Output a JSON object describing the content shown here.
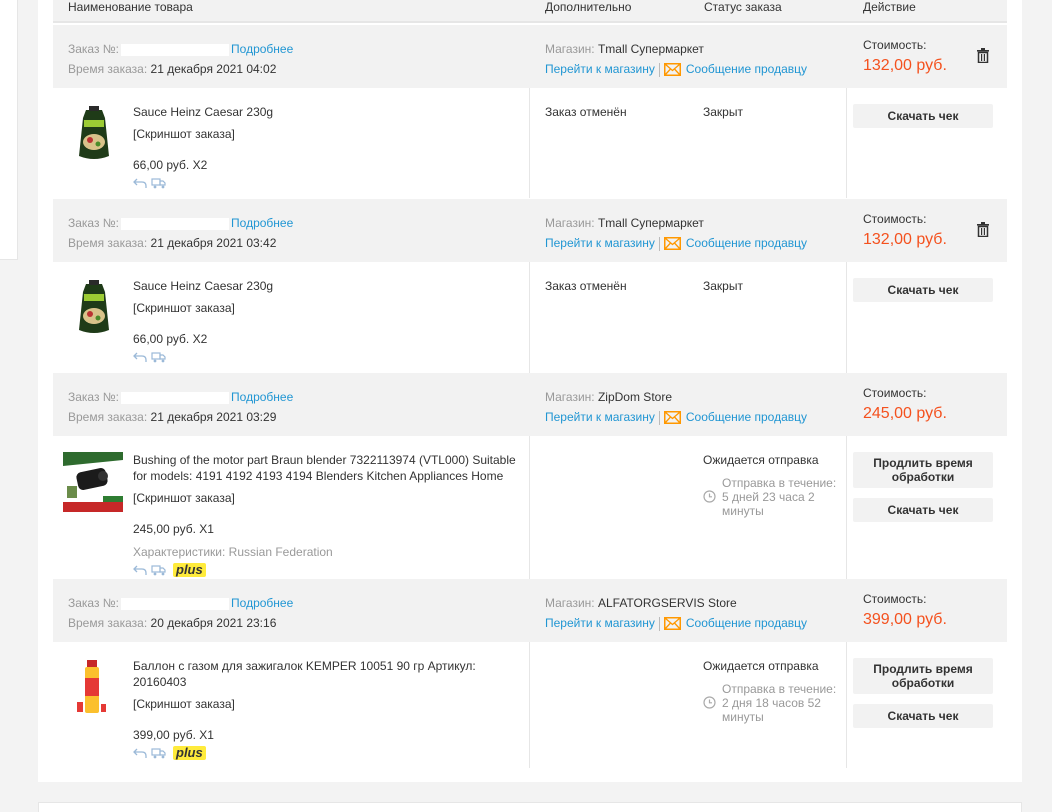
{
  "table_header": {
    "name": "Наименование товара",
    "extra": "Дополнительно",
    "status": "Статус заказа",
    "action": "Действие"
  },
  "labels": {
    "order_no": "Заказ №:",
    "order_time": "Время заказа:",
    "details": "Подробнее",
    "shop": "Магазин:",
    "go_shop": "Перейти к магазину",
    "message_seller": "Сообщение продавцу",
    "cost": "Стоимость:",
    "download_receipt": "Скачать чек",
    "extend_processing": "Продлить время обработки",
    "screenshot": "[Скриншот заказа]",
    "ship_within": "Отправка в течение:",
    "characteristics": "Характеристики:",
    "plus": "plus"
  },
  "orders": [
    {
      "time": "21 декабря 2021 04:02",
      "shop": "Tmall Супермаркет",
      "cost": "132,00 руб.",
      "product": "Sauce Heinz Caesar 230g",
      "price": "66,00 руб. X2",
      "extra": "Заказ отменён",
      "status": "Закрыт"
    },
    {
      "time": "21 декабря 2021 03:42",
      "shop": "Tmall Супермаркет",
      "cost": "132,00 руб.",
      "product": "Sauce Heinz Caesar 230g",
      "price": "66,00 руб. X2",
      "extra": "Заказ отменён",
      "status": "Закрыт"
    },
    {
      "time": "21 декабря 2021 03:29",
      "shop": "ZipDom Store",
      "cost": "245,00 руб.",
      "product": "Bushing of the motor part Braun blender 7322113974 (VTL000) Suitable for models: 4191 4192 4193 4194 Blenders Kitchen Appliances Home",
      "price": "245,00 руб. X1",
      "chars": "Russian Federation",
      "status": "Ожидается отправка",
      "ship_time": "5 дней 23 часа 2 минуты"
    },
    {
      "time": "20 декабря 2021 23:16",
      "shop": "ALFATORGSERVIS Store",
      "cost": "399,00 руб.",
      "product": "Баллон с газом для зажигалок KEMPER 10051 90 гр Артикул: 20160403",
      "price": "399,00 руб. X1",
      "status": "Ожидается отправка",
      "ship_time": "2 дня 18 часов 52 минуты"
    }
  ],
  "colors": {
    "link": "#2196d3",
    "price": "#f4511e",
    "mail": "#ff9800",
    "plus_badge": "#ffeb3b"
  }
}
